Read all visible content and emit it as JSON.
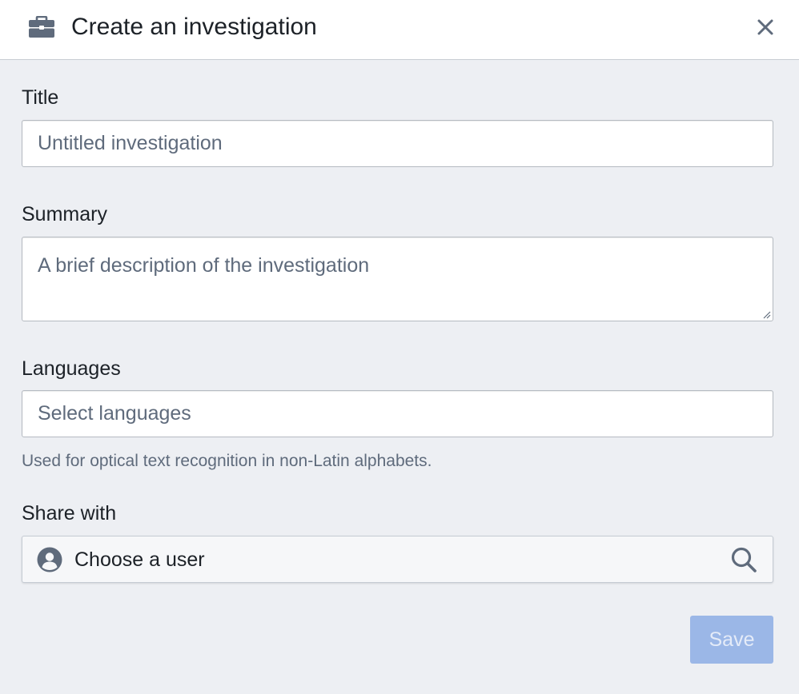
{
  "dialog": {
    "title": "Create an investigation",
    "icon": "briefcase-icon",
    "close_icon": "close-icon"
  },
  "form": {
    "title_label": "Title",
    "title_placeholder": "Untitled investigation",
    "summary_label": "Summary",
    "summary_placeholder": "A brief description of the investigation",
    "languages_label": "Languages",
    "languages_placeholder": "Select languages",
    "languages_helper": "Used for optical text recognition in non-Latin alphabets.",
    "share_label": "Share with",
    "share_placeholder": "Choose a user",
    "save_label": "Save"
  },
  "colors": {
    "save_disabled": "#9bb7e7",
    "background": "#edeff3"
  }
}
